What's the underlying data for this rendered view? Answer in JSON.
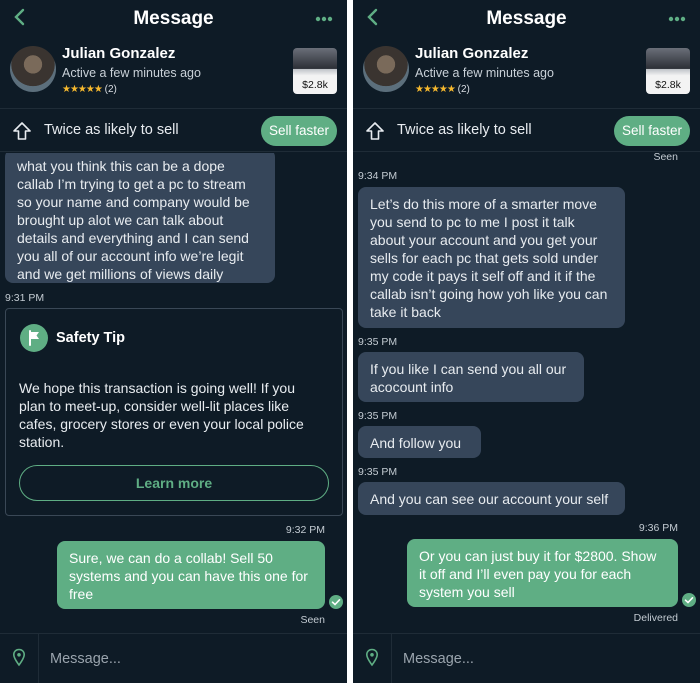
{
  "screens": [
    {
      "header": {
        "title": "Message"
      },
      "user": {
        "name": "Julian Gonzalez",
        "active": "Active a few minutes ago",
        "stars": "★★★★★",
        "rating_count": "(2)"
      },
      "item": {
        "price": "$2.8k"
      },
      "promo": {
        "text": "Twice as likely to sell",
        "button": "Sell faster"
      },
      "messages": {
        "m1": "what you think this can be a dope callab I’m trying to get a pc to stream so your name and company would be brought up alot we can talk about details and everything and I can send you all of our account info we’re legit and we get millions of views daily",
        "t1": "9:31 PM",
        "tip_title": "Safety Tip",
        "tip_body": "We hope this transaction is going well! If you plan to meet-up, consider well-lit places like cafes, grocery stores or even your local police station.",
        "tip_button": "Learn more",
        "t2": "9:32 PM",
        "m2": "Sure, we can do a collab! Sell 50 systems and you can have this one for free",
        "status": "Seen"
      },
      "composer": {
        "placeholder": "Message..."
      }
    },
    {
      "header": {
        "title": "Message"
      },
      "user": {
        "name": "Julian Gonzalez",
        "active": "Active a few minutes ago",
        "stars": "★★★★★",
        "rating_count": "(2)"
      },
      "item": {
        "price": "$2.8k"
      },
      "promo": {
        "text": "Twice as likely to sell",
        "button": "Sell faster"
      },
      "messages": {
        "seen_top": "Seen",
        "t1": "9:34 PM",
        "m1": "Let’s do this more of a smarter move you send to pc to me I post it talk about your account and you get your sells for each pc that gets sold under my code it pays it self off and it if the callab isn’t going how yoh like you can take it back",
        "t2": "9:35 PM",
        "m2": "If you like I can send you all our acocount info",
        "t3": "9:35 PM",
        "m3": "And follow you",
        "t4": "9:35 PM",
        "m4": "And you can see our account your self",
        "t5": "9:36 PM",
        "m5": "Or you can just buy it for $2800. Show it off and I’ll even pay you for each system you sell",
        "status": "Delivered"
      },
      "composer": {
        "placeholder": "Message..."
      }
    }
  ]
}
